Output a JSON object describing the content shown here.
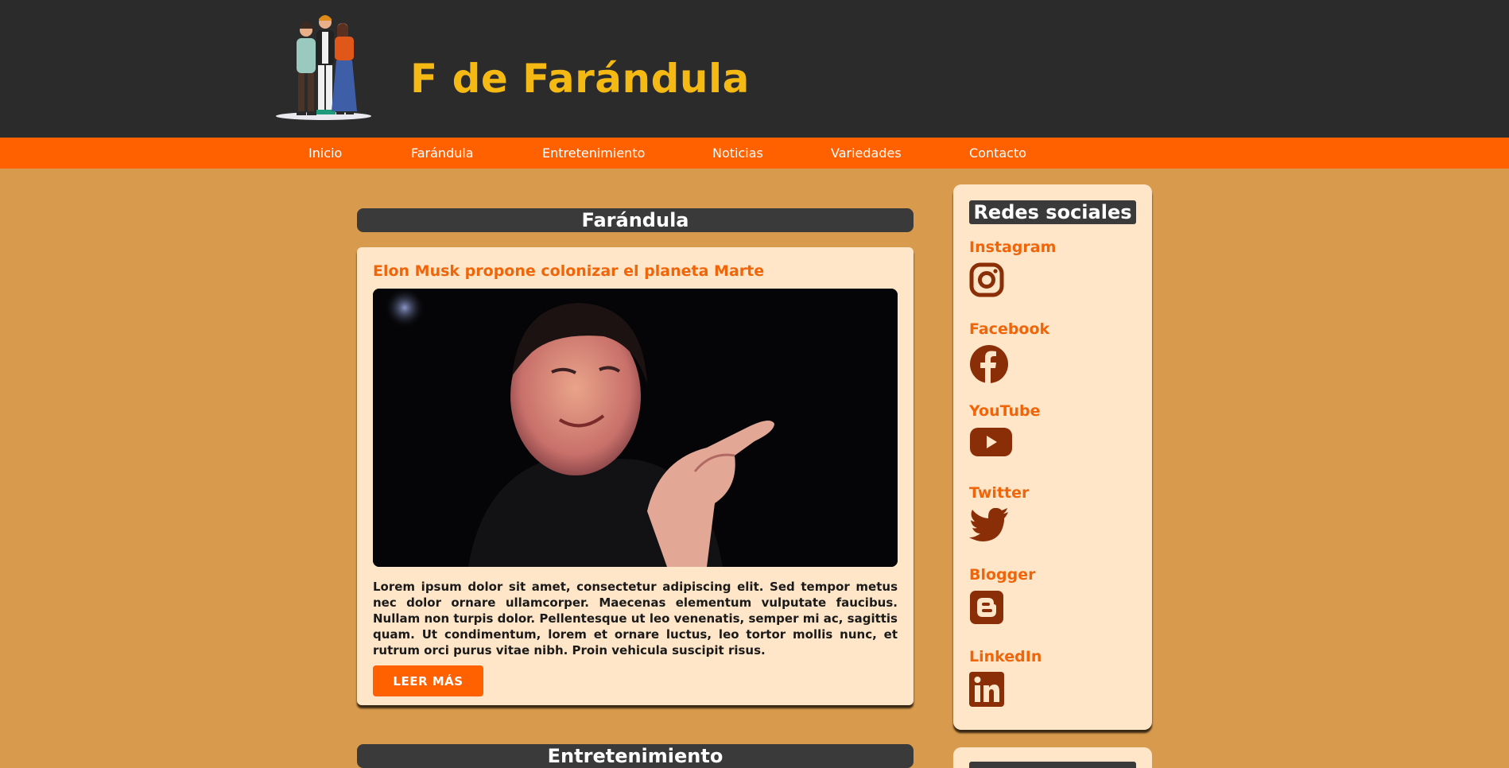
{
  "header": {
    "site_title": "F de Farándula"
  },
  "nav": {
    "items": [
      "Inicio",
      "Farándula",
      "Entretenimiento",
      "Noticias",
      "Variedades",
      "Contacto"
    ]
  },
  "sections": [
    {
      "heading": "Farándula",
      "article": {
        "title": "Elon Musk propone colonizar el planeta Marte",
        "body": "Lorem ipsum dolor sit amet, consectetur adipiscing elit. Sed tempor metus nec dolor ornare ullamcorper. Maecenas elementum vulputate faucibus. Nullam non turpis dolor. Pellentesque ut leo venenatis, semper mi ac, sagittis quam. Ut condimentum, lorem et ornare luctus, leo tortor mollis nunc, et rutrum orci purus vitae nibh. Proin vehicula suscipit risus.",
        "button_label": "LEER MÁS"
      }
    },
    {
      "heading": "Entretenimiento"
    }
  ],
  "sidebar": {
    "title": "Redes sociales",
    "networks": [
      {
        "name": "Instagram",
        "icon": "instagram-icon"
      },
      {
        "name": "Facebook",
        "icon": "facebook-icon"
      },
      {
        "name": "YouTube",
        "icon": "youtube-icon"
      },
      {
        "name": "Twitter",
        "icon": "twitter-icon"
      },
      {
        "name": "Blogger",
        "icon": "blogger-icon"
      },
      {
        "name": "LinkedIn",
        "icon": "linkedin-icon"
      }
    ]
  },
  "colors": {
    "background": "#d89a4c",
    "header": "#2b2b2b",
    "nav": "#ff6000",
    "title": "#f5b914",
    "accent": "#f0650a",
    "card": "#ffe6c8",
    "icon": "#8a2e08"
  }
}
